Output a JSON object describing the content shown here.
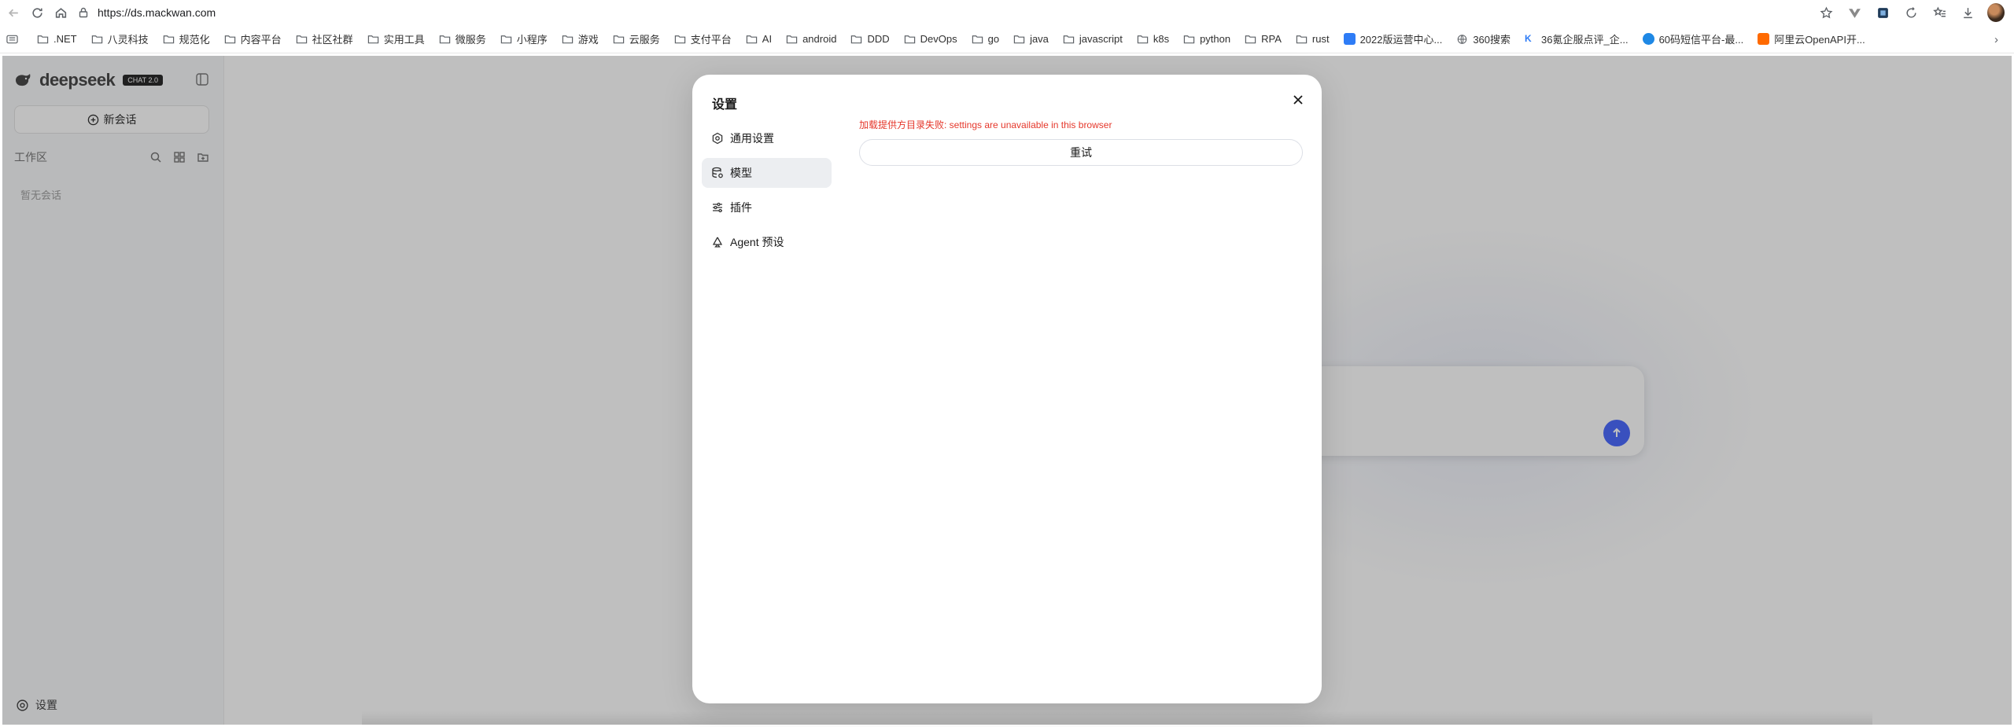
{
  "browser": {
    "url": "https://ds.mackwan.com",
    "bookmarks": [
      ".NET",
      "八灵科技",
      "规范化",
      "内容平台",
      "社区社群",
      "实用工具",
      "微服务",
      "小程序",
      "游戏",
      "云服务",
      "支付平台",
      "AI",
      "android",
      "DDD",
      "DevOps",
      "go",
      "java",
      "javascript",
      "k8s",
      "python",
      "RPA",
      "rust"
    ],
    "site_bookmarks": [
      "2022版运营中心...",
      "360搜索",
      "36氪企服点评_企...",
      "60码短信平台-最...",
      "阿里云OpenAPI开..."
    ]
  },
  "sidebar": {
    "logo_text": "deepseek",
    "logo_badge": "CHAT 2.0",
    "new_chat": "新会话",
    "workspace_label": "工作区",
    "empty_note": "暂无会话",
    "settings_label": "设置"
  },
  "dialog": {
    "title": "设置",
    "nav": [
      "通用设置",
      "模型",
      "插件",
      "Agent 预设"
    ],
    "active_index": 1,
    "error_text": "加载提供方目录失败: settings are unavailable in this browser",
    "retry_label": "重试"
  },
  "colors": {
    "accent": "#4d6bfe",
    "error": "#e5372b",
    "nav_active_bg": "#eceef1"
  }
}
